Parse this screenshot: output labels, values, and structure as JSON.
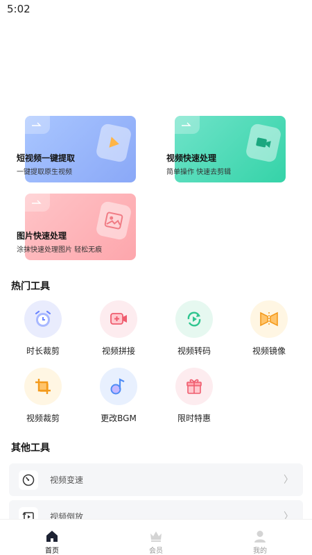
{
  "status_bar": {
    "time": "5:02"
  },
  "feature_cards": [
    {
      "title": "短视频一键提取",
      "subtitle": "一键提取原生视频"
    },
    {
      "title": "视频快速处理",
      "subtitle": "简单操作 快速去剪辑"
    },
    {
      "title": "图片快速处理",
      "subtitle": "涂抹快速处理图片 轻松无痕"
    }
  ],
  "hot_tools": {
    "title": "热门工具",
    "items": [
      {
        "label": "时长裁剪",
        "icon": "alarm-clock-icon"
      },
      {
        "label": "视频拼接",
        "icon": "video-add-icon"
      },
      {
        "label": "视频转码",
        "icon": "refresh-play-icon"
      },
      {
        "label": "视频镜像",
        "icon": "mirror-icon"
      },
      {
        "label": "视频裁剪",
        "icon": "crop-icon"
      },
      {
        "label": "更改BGM",
        "icon": "music-note-icon"
      },
      {
        "label": "限时特惠",
        "icon": "gift-icon"
      }
    ]
  },
  "other_tools": {
    "title": "其他工具",
    "items": [
      {
        "label": "视频变速",
        "icon": "speed-gauge-icon"
      },
      {
        "label": "视频倒放",
        "icon": "reverse-play-icon"
      }
    ],
    "chevron": "〉"
  },
  "bottom_nav": [
    {
      "label": "首页",
      "icon": "home-icon",
      "active": true
    },
    {
      "label": "会员",
      "icon": "crown-icon",
      "active": false
    },
    {
      "label": "我的",
      "icon": "user-icon",
      "active": false
    }
  ],
  "colors": {
    "card_blue": "#8aa8f7",
    "card_green": "#35d3a8",
    "card_pink": "#fda6ac",
    "active_nav": "#141414",
    "inactive_nav": "#9a9a9a"
  }
}
